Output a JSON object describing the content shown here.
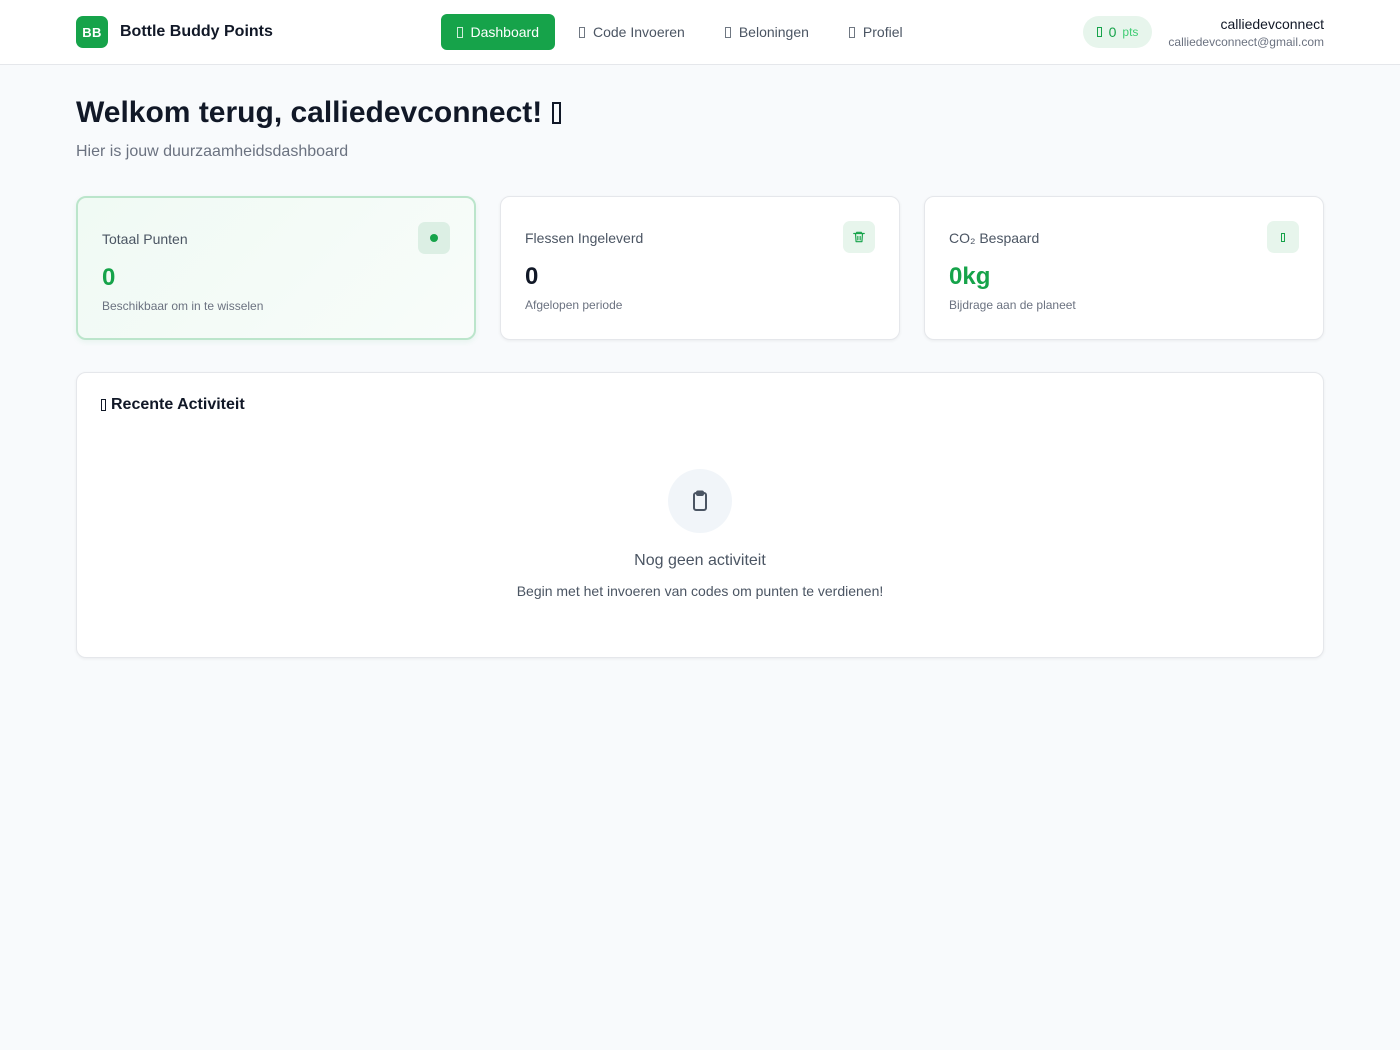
{
  "brand": {
    "logo_text": "BB",
    "name": "Bottle Buddy Points"
  },
  "nav": {
    "items": [
      {
        "label": "Dashboard",
        "icon": "home-icon",
        "active": true
      },
      {
        "label": "Code Invoeren",
        "icon": "code-icon",
        "active": false
      },
      {
        "label": "Beloningen",
        "icon": "gift-icon",
        "active": false
      },
      {
        "label": "Profiel",
        "icon": "user-icon",
        "active": false
      }
    ]
  },
  "header": {
    "points_value": "0",
    "points_unit": "pts",
    "user_name": "calliedevconnect",
    "user_email": "calliedevconnect@gmail.com"
  },
  "welcome": {
    "title": "Welkom terug, calliedevconnect!",
    "subtitle": "Hier is jouw duurzaamheidsdashboard"
  },
  "cards": {
    "points": {
      "label": "Totaal Punten",
      "value": "0",
      "sub": "Beschikbaar om in te wisselen",
      "icon": "points-dot-icon"
    },
    "bottles": {
      "label": "Flessen Ingeleverd",
      "value": "0",
      "sub": "Afgelopen periode",
      "icon": "trash-icon"
    },
    "co2": {
      "label": "CO₂ Bespaard",
      "value": "0kg",
      "sub": "Bijdrage aan de planeet",
      "icon": "leaf-icon"
    }
  },
  "activity": {
    "title": "Recente Activiteit",
    "empty_title": "Nog geen activiteit",
    "empty_desc": "Begin met het invoeren van codes om punten te verdienen!",
    "empty_icon": "clipboard-icon"
  },
  "colors": {
    "accent": "#16a34a",
    "accent_light": "#e7f5ec",
    "background": "#f8fafc",
    "text": "#111827",
    "muted": "#6b7280"
  }
}
